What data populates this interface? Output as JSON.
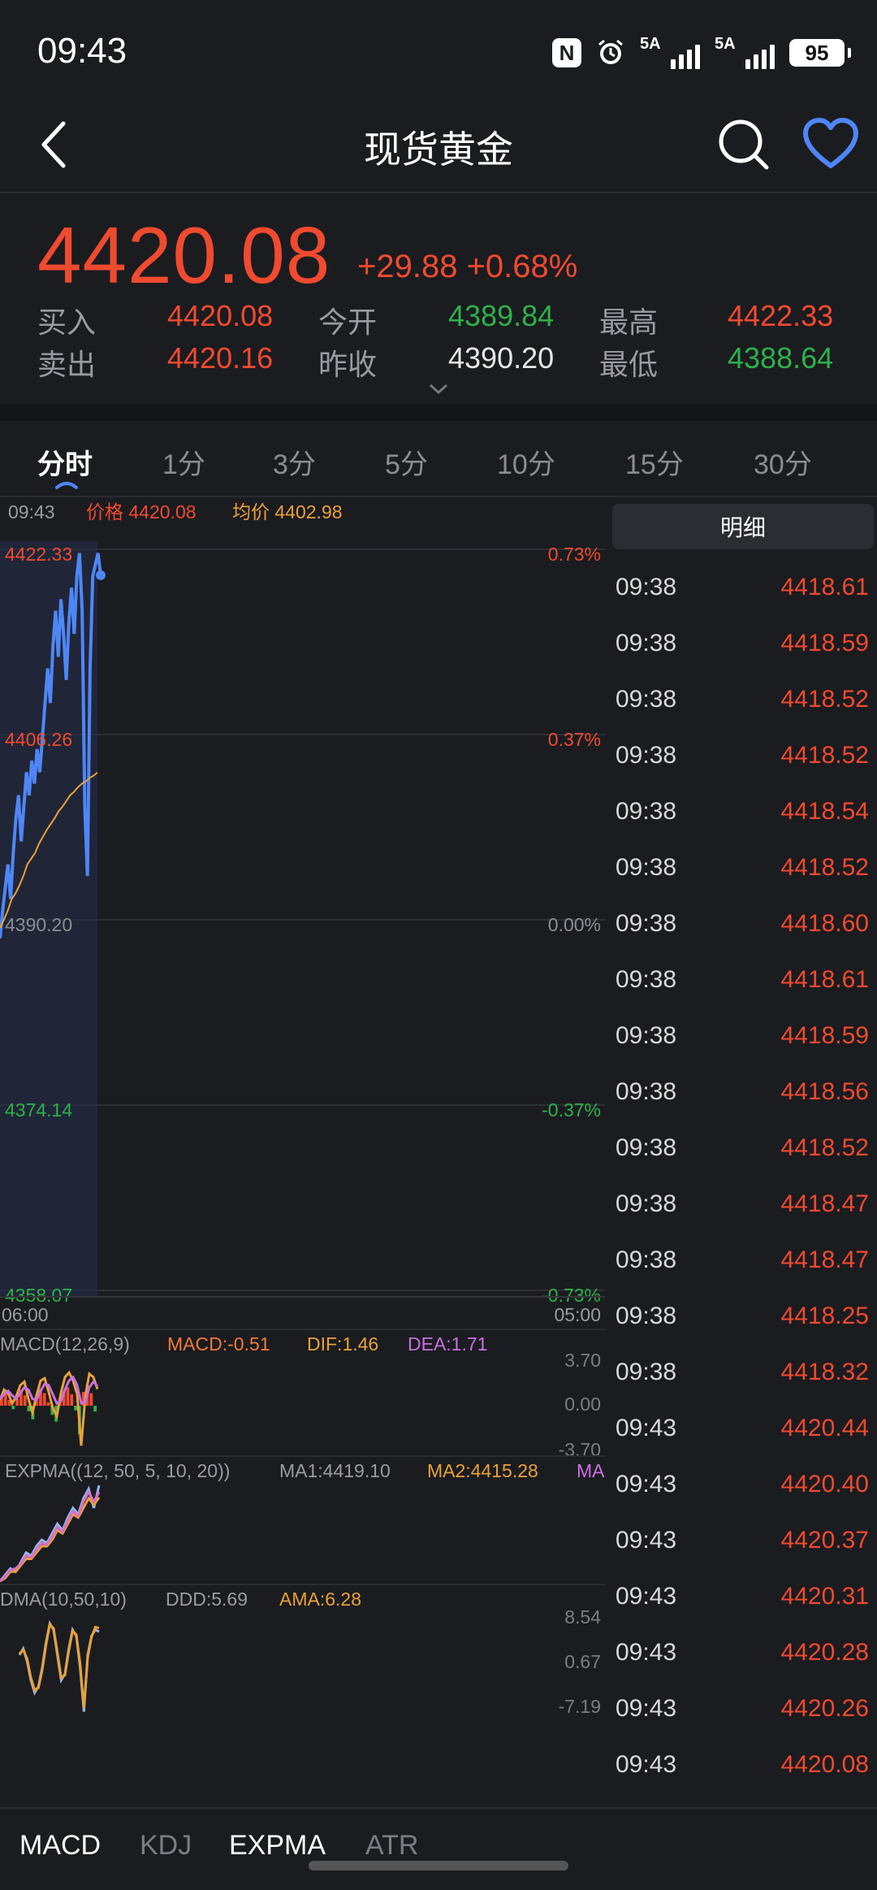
{
  "status_bar": {
    "time": "09:43",
    "nfc_label": "N",
    "signal1_label": "5A",
    "signal2_label": "5A",
    "battery": "95"
  },
  "header": {
    "title": "现货黄金"
  },
  "quote": {
    "price": "4420.08",
    "change": "+29.88 +0.68%",
    "rows": [
      {
        "label1": "买入",
        "value1": "4420.08",
        "label2": "今开",
        "value2": "4389.84",
        "label3": "最高",
        "value3": "4422.33"
      },
      {
        "label1": "卖出",
        "value1": "4420.16",
        "label2": "昨收",
        "value2": "4390.20",
        "label3": "最低",
        "value3": "4388.64"
      }
    ]
  },
  "tabs": [
    "分时",
    "1分",
    "3分",
    "5分",
    "10分",
    "15分",
    "30分"
  ],
  "active_tab": "分时",
  "chart_info": {
    "time": "09:43",
    "price_label": "价格 4420.08",
    "avg_label": "均价 4402.98"
  },
  "colors": {
    "up": "#f04a2f",
    "down": "#2eb14a",
    "price_line": "#4f86f7",
    "avg_line": "#e8a13a",
    "background": "#1b1c20"
  },
  "chart_data": [
    {
      "type": "line",
      "name": "intraday",
      "y_ticks_left": [
        "4422.33",
        "4406.26",
        "4390.20",
        "4374.14",
        "4358.07"
      ],
      "y_ticks_right": [
        "0.73%",
        "0.37%",
        "0.00%",
        "-0.37%",
        "-0.73%"
      ],
      "ylim": [
        4358.07,
        4422.33
      ],
      "x_ticks": [
        "06:00",
        "05:00"
      ],
      "series": [
        {
          "name": "价格",
          "points": [
            4388.6,
            4391,
            4393,
            4395,
            4392,
            4396,
            4399,
            4401,
            4397,
            4400,
            4403,
            4401,
            4404,
            4402,
            4405,
            4403,
            4406,
            4409,
            4412,
            4409,
            4414,
            4417,
            4413,
            4418,
            4415,
            4411,
            4416,
            4419,
            4415,
            4420,
            4422,
            4417,
            4400,
            4394,
            4412,
            4420,
            4421,
            4422,
            4420.08
          ]
        },
        {
          "name": "均价",
          "points": [
            4389.5,
            4390.2,
            4391,
            4392,
            4392.5,
            4393.2,
            4394,
            4395,
            4395.5,
            4396,
            4396.8,
            4397.4,
            4398,
            4398.5,
            4399,
            4399.6,
            4400,
            4400.5,
            4401,
            4401.3,
            4401.7,
            4402,
            4402.2,
            4402.5,
            4402.7,
            4402.98
          ]
        }
      ]
    },
    {
      "type": "bar",
      "name": "MACD",
      "label": "MACD(12,26,9)",
      "macd": "MACD:-0.51",
      "dif": "DIF:1.46",
      "dea": "DEA:1.71",
      "y_ticks": [
        "3.70",
        "0.00",
        "-3.70"
      ],
      "ylim": [
        -3.7,
        3.7
      ],
      "values": [
        0.8,
        1.2,
        0.5,
        -0.3,
        0.6,
        1.4,
        0.9,
        -0.5,
        -1.2,
        0.4,
        1.5,
        1.1,
        0.3,
        -0.8,
        -1.4,
        0.7,
        1.3,
        1.6,
        1.0,
        -0.4,
        -2.5,
        1.2,
        1.8,
        1.1,
        -0.51
      ],
      "dif_values": [
        0.5,
        1.4,
        1.1,
        0.2,
        0.8,
        1.8,
        2.1,
        0.6,
        -0.6,
        0.9,
        2.2,
        2.4,
        1.2,
        -0.2,
        -0.9,
        1.1,
        2.5,
        2.9,
        2.2,
        1.0,
        -3.5,
        0.8,
        2.8,
        2.5,
        1.46
      ],
      "dea_values": [
        0.6,
        1.0,
        1.3,
        0.9,
        0.6,
        1.1,
        1.6,
        1.4,
        0.6,
        0.5,
        1.3,
        1.9,
        1.8,
        1.0,
        0.2,
        0.4,
        1.4,
        2.2,
        2.5,
        1.8,
        0.2,
        0.3,
        1.6,
        2.1,
        1.71
      ]
    },
    {
      "type": "line",
      "name": "EXPMA",
      "label": "EXPMA((12, 50, 5, 10, 20))",
      "ma1": "MA1:4419.10",
      "ma2": "MA2:4415.28",
      "ma3": "MA",
      "series": [
        {
          "name": "MA1",
          "points": [
            4389,
            4391,
            4393,
            4392,
            4395,
            4398,
            4397,
            4400,
            4402,
            4401,
            4404,
            4407,
            4405,
            4409,
            4412,
            4410,
            4415,
            4418,
            4412,
            4419.1
          ]
        },
        {
          "name": "MA2",
          "points": [
            4389,
            4390,
            4392,
            4392,
            4394,
            4396,
            4396,
            4398,
            4400,
            4400,
            4402,
            4405,
            4404,
            4407,
            4410,
            4409,
            4412,
            4415,
            4413,
            4415.28
          ]
        },
        {
          "name": "MA3",
          "points": [
            4389,
            4390.5,
            4392.5,
            4393,
            4394.5,
            4397,
            4396.5,
            4399,
            4401,
            4400.5,
            4403,
            4406,
            4404.5,
            4408,
            4411,
            4409.5,
            4414,
            4417,
            4414,
            4417
          ]
        }
      ]
    },
    {
      "type": "line",
      "name": "DMA",
      "label": "DMA(10,50,10)",
      "ddd": "DDD:5.69",
      "ama": "AMA:6.28",
      "y_ticks": [
        "8.54",
        "0.67",
        "-7.19"
      ],
      "ylim": [
        -7.19,
        8.54
      ],
      "series": [
        {
          "name": "DDD",
          "points": [
            2,
            3,
            1,
            -2,
            -4,
            -3,
            0,
            4,
            7,
            6,
            2,
            -2,
            -1,
            3,
            6,
            5,
            0,
            -7,
            2,
            5,
            6,
            5.69
          ]
        },
        {
          "name": "AMA",
          "points": [
            2.2,
            2.8,
            1.4,
            -1.6,
            -3.6,
            -3.2,
            -0.4,
            3.6,
            6.8,
            6.2,
            2.4,
            -1.6,
            -1.2,
            2.6,
            5.8,
            5.2,
            0.6,
            -6.4,
            1.6,
            4.8,
            6.4,
            6.28
          ]
        }
      ]
    }
  ],
  "details": {
    "button": "明细",
    "ticks": [
      {
        "time": "09:38",
        "price": "4418.61"
      },
      {
        "time": "09:38",
        "price": "4418.59"
      },
      {
        "time": "09:38",
        "price": "4418.52"
      },
      {
        "time": "09:38",
        "price": "4418.52"
      },
      {
        "time": "09:38",
        "price": "4418.54"
      },
      {
        "time": "09:38",
        "price": "4418.52"
      },
      {
        "time": "09:38",
        "price": "4418.60"
      },
      {
        "time": "09:38",
        "price": "4418.61"
      },
      {
        "time": "09:38",
        "price": "4418.59"
      },
      {
        "time": "09:38",
        "price": "4418.56"
      },
      {
        "time": "09:38",
        "price": "4418.52"
      },
      {
        "time": "09:38",
        "price": "4418.47"
      },
      {
        "time": "09:38",
        "price": "4418.47"
      },
      {
        "time": "09:38",
        "price": "4418.25"
      },
      {
        "time": "09:38",
        "price": "4418.32"
      },
      {
        "time": "09:43",
        "price": "4420.44"
      },
      {
        "time": "09:43",
        "price": "4420.40"
      },
      {
        "time": "09:43",
        "price": "4420.37"
      },
      {
        "time": "09:43",
        "price": "4420.31"
      },
      {
        "time": "09:43",
        "price": "4420.28"
      },
      {
        "time": "09:43",
        "price": "4420.26"
      },
      {
        "time": "09:43",
        "price": "4420.08"
      }
    ]
  },
  "bottom_tabs": [
    "MACD",
    "KDJ",
    "EXPMA",
    "ATR"
  ],
  "bottom_tabs_active": [
    "MACD",
    "EXPMA"
  ]
}
